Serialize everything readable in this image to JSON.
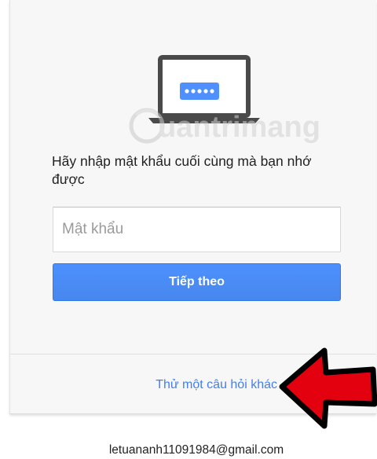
{
  "prompt": {
    "text": "Hãy nhập mật khẩu cuối cùng mà bạn nhớ được"
  },
  "password": {
    "placeholder": "Mật khẩu",
    "value": ""
  },
  "next_button": {
    "label": "Tiếp theo"
  },
  "alternate_question_link": {
    "label": "Thử một câu hỏi khác"
  },
  "account": {
    "email": "letuananh11091984@gmail.com"
  },
  "watermark": {
    "text": "uantrimang"
  },
  "icons": {
    "illustration": "laptop-password-icon",
    "annotation": "red-arrow-icon"
  },
  "colors": {
    "accent": "#4d90fe",
    "link": "#427fed",
    "arrow": "#e3000f",
    "laptop": "#4a4a4a"
  }
}
